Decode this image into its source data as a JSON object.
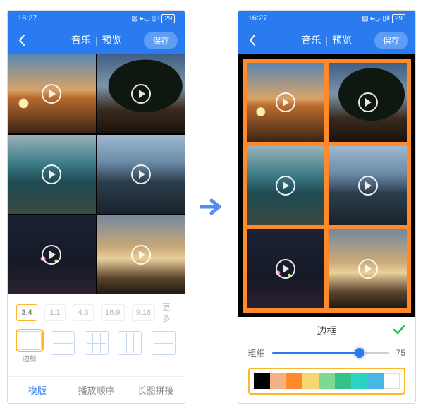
{
  "statusbar": {
    "time": "16:27",
    "battery": "29"
  },
  "header": {
    "back_icon": "back-chevron-icon",
    "music_label": "音乐",
    "preview_label": "预览",
    "save_label": "保存"
  },
  "grid": {
    "border_color": "#ff8a2b",
    "cells": [
      {
        "name": "sunset-tree",
        "play": true
      },
      {
        "name": "tree-dark",
        "play": true
      },
      {
        "name": "lake",
        "play": true
      },
      {
        "name": "car",
        "play": true
      },
      {
        "name": "city-night",
        "play": true
      },
      {
        "name": "dusk",
        "play": true
      }
    ]
  },
  "panelA": {
    "ratios": [
      {
        "label": "3:4",
        "active": true
      },
      {
        "label": "1:1"
      },
      {
        "label": "4:3"
      },
      {
        "label": "16:9"
      },
      {
        "label": "9:16"
      }
    ],
    "more_label": "更多",
    "layouts": {
      "border_label": "边框"
    },
    "tabs": {
      "template_label": "模版",
      "order_label": "播放顺序",
      "long_stitch_label": "长图拼接",
      "active": "template"
    }
  },
  "panelB": {
    "title": "边框",
    "confirm_icon": "check-icon",
    "thickness_label": "粗细",
    "thickness_value": 75,
    "swatches": [
      "#000000",
      "#f4b183",
      "#ff8a2b",
      "#f6d776",
      "#7cd98f",
      "#35c18a",
      "#2bd3c1",
      "#49b7e4",
      "#ffffff"
    ]
  },
  "arrow": {
    "icon": "arrow-right-icon",
    "color": "#4f8ef2"
  }
}
